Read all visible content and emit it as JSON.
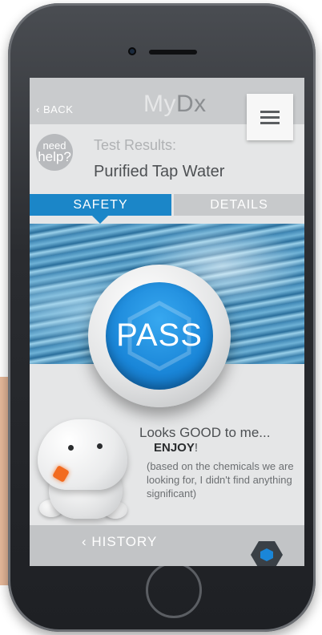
{
  "header": {
    "back_label": "BACK",
    "logo_prefix": "My",
    "logo_suffix": "Dx"
  },
  "help": {
    "line1": "need",
    "line2": "help?"
  },
  "result": {
    "label": "Test Results:",
    "value": "Purified Tap Water"
  },
  "tabs": [
    {
      "label": "SAFETY",
      "active": true
    },
    {
      "label": "DETAILS",
      "active": false
    }
  ],
  "badge": {
    "text": "PASS",
    "color": "#1a86d8"
  },
  "message": {
    "line1": "Looks GOOD to me...",
    "enjoy": "ENJOY",
    "exclaim": "!",
    "note": "(based on the chemicals we are looking for, I didn't find anything significant)"
  },
  "footer": {
    "history_label": "HISTORY"
  },
  "colors": {
    "accent": "#1b86c8",
    "tab_inactive": "#c7c9cb",
    "robot_light": "#f26b1f"
  }
}
